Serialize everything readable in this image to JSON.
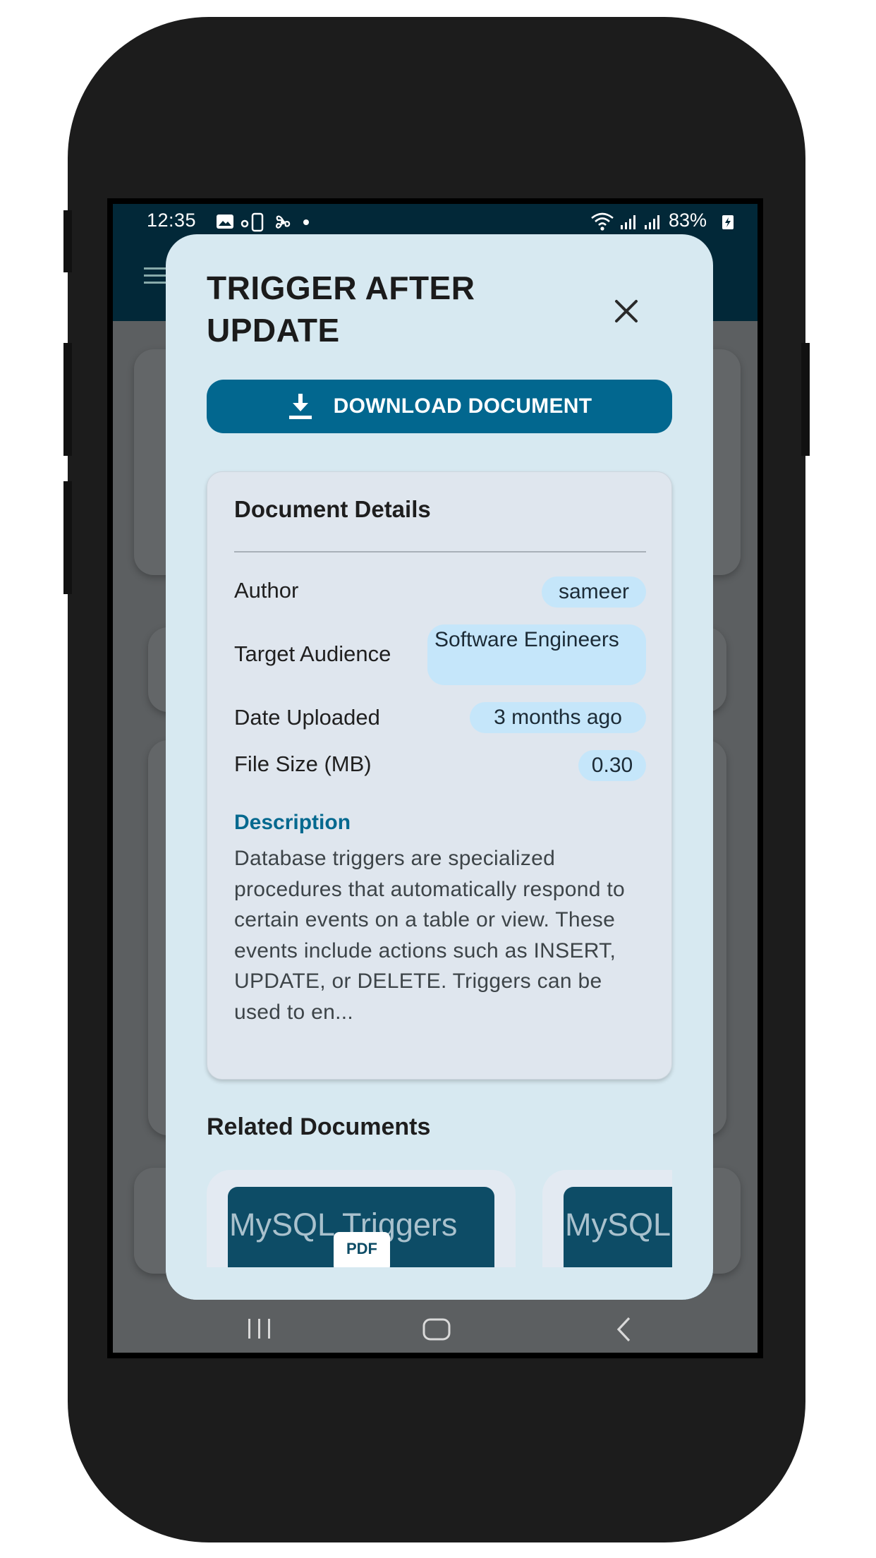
{
  "status_bar": {
    "time": "12:35",
    "battery": "83%",
    "icons": [
      "image-icon",
      "location-icon",
      "phone-icon",
      "fan-icon",
      "dot-icon",
      "wifi-icon",
      "signal-icon",
      "signal-icon",
      "battery-charging-icon"
    ]
  },
  "modal": {
    "title": "TRIGGER AFTER UPDATE",
    "close_icon": "close-icon",
    "download_label": "DOWNLOAD DOCUMENT",
    "download_icon": "download-icon"
  },
  "details": {
    "heading": "Document Details",
    "rows": [
      {
        "label": "Author",
        "value": "sameer"
      },
      {
        "label": "Target Audience",
        "value": "Software Engineers"
      },
      {
        "label": "Date Uploaded",
        "value": "3 months ago"
      },
      {
        "label": "File Size (MB)",
        "value": "0.30"
      }
    ],
    "description_heading": "Description",
    "description": "Database triggers are specialized procedures that automatically respond to certain events on a table or view. These events include actions such as INSERT, UPDATE, or DELETE. Triggers can be used to en..."
  },
  "related": {
    "heading": "Related Documents",
    "items": [
      {
        "thumb_text": "MySQL Triggers",
        "badge": "PDF"
      },
      {
        "thumb_text": "MySQL",
        "badge": ""
      }
    ]
  },
  "colors": {
    "app_bar": "#022838",
    "modal_bg": "#d7e9f1",
    "primary_button": "#02678f",
    "pill": "#c5e6fa",
    "accent_text": "#05698f"
  }
}
